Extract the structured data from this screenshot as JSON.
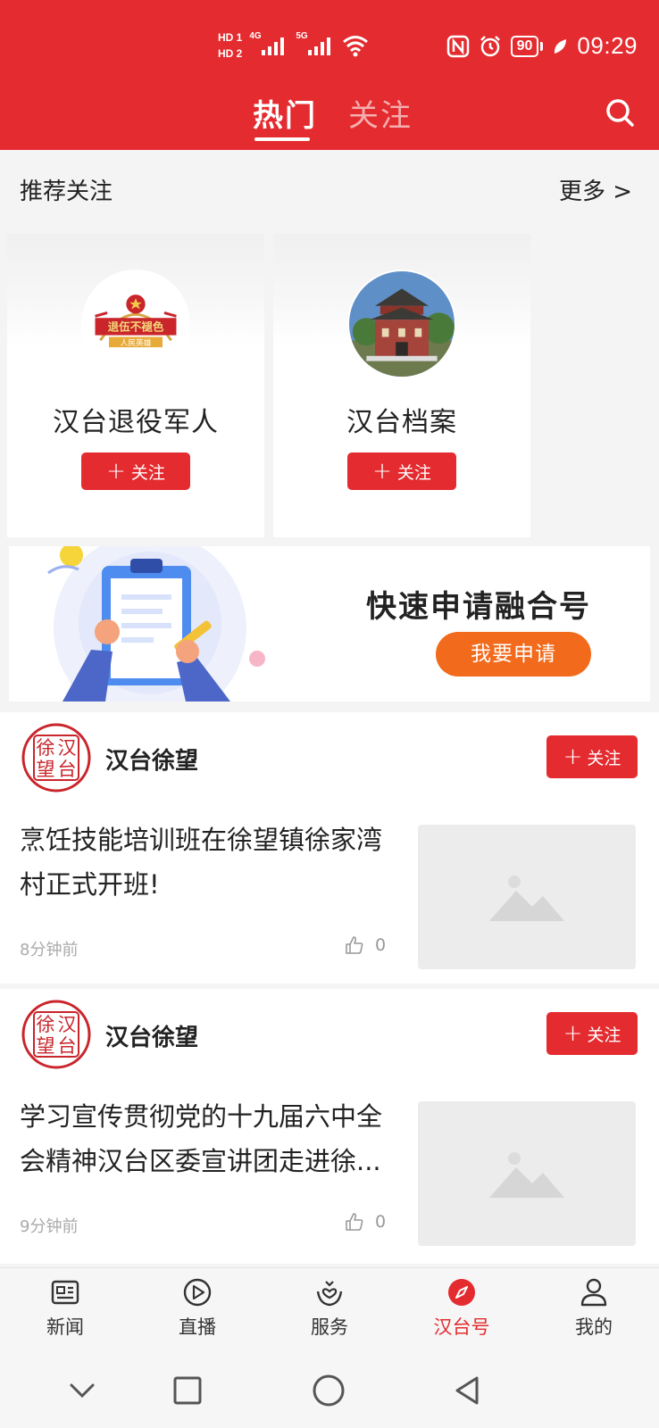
{
  "status_bar": {
    "hd1": "HD 1",
    "hd2": "HD 2",
    "net1": "4G",
    "net2": "5G",
    "battery": "90",
    "time": "09:29"
  },
  "header": {
    "tabs": [
      {
        "label": "热门",
        "active": true
      },
      {
        "label": "关注",
        "active": false
      }
    ],
    "search_icon": "search-icon",
    "bg_color": "#e42b2f"
  },
  "recommend": {
    "title": "推荐关注",
    "more_label": "更多 >",
    "cards": [
      {
        "name": "汉台退役军人",
        "follow_label": "关注",
        "avatar_text": "退伍不褪色",
        "avatar_sub": "人民英雄"
      },
      {
        "name": "汉台档案",
        "follow_label": "关注"
      }
    ]
  },
  "banner": {
    "title": "快速申请融合号",
    "button_label": "我要申请",
    "button_color": "#f26a1b"
  },
  "feed": [
    {
      "seal_chars": [
        "汉",
        "徐",
        "台",
        "望"
      ],
      "author": "汉台徐望",
      "follow_label": "关注",
      "title": "烹饪技能培训班在徐望镇徐家湾村正式开班!",
      "time": "8分钟前",
      "likes": "0"
    },
    {
      "seal_chars": [
        "汉",
        "徐",
        "台",
        "望"
      ],
      "author": "汉台徐望",
      "follow_label": "关注",
      "title": "学习宣传贯彻党的十九届六中全会精神汉台区委宣讲团走进徐...",
      "time": "9分钟前",
      "likes": "0"
    }
  ],
  "bottom_nav": [
    {
      "label": "新闻",
      "icon": "news-icon",
      "active": false
    },
    {
      "label": "直播",
      "icon": "play-icon",
      "active": false
    },
    {
      "label": "服务",
      "icon": "service-icon",
      "active": false
    },
    {
      "label": "汉台号",
      "icon": "compass-icon",
      "active": true
    },
    {
      "label": "我的",
      "icon": "user-icon",
      "active": false
    }
  ],
  "system_nav": [
    "chevron-down-icon",
    "recents-icon",
    "home-icon",
    "back-icon"
  ],
  "colors": {
    "accent": "#e42b2f",
    "orange": "#f26a1b"
  }
}
